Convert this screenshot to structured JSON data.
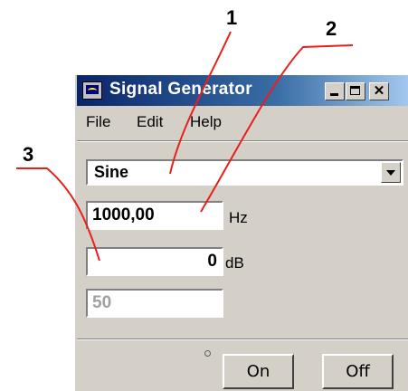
{
  "window": {
    "title": "Signal Generator"
  },
  "menu": {
    "items": [
      "File",
      "Edit",
      "Help"
    ]
  },
  "waveform": {
    "selected": "Sine"
  },
  "frequency": {
    "value": "1000,00",
    "unit": "Hz"
  },
  "level": {
    "value": "0",
    "unit": "dB"
  },
  "third_field": {
    "value": "50"
  },
  "buttons": {
    "on": "On",
    "off": "Off"
  },
  "callouts": [
    "1",
    "2",
    "3"
  ],
  "colors": {
    "callout_line": "#e8201c",
    "titlebar_start": "#0a246a",
    "titlebar_end": "#a6caf0",
    "dialog_face": "#d4d0c8"
  }
}
